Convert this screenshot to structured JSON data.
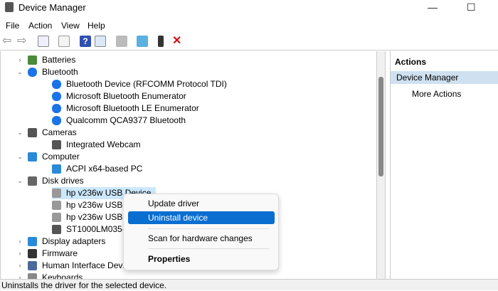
{
  "window": {
    "title": "Device Manager",
    "minimize": "—",
    "maximize": "☐"
  },
  "menu": [
    "File",
    "Action",
    "View",
    "Help"
  ],
  "toolbar": [
    "back",
    "forward",
    "show-hide-console-tree",
    "properties",
    "help",
    "show-hide-action-pane",
    "update-driver",
    "scan-hardware",
    "enable-device",
    "uninstall-device"
  ],
  "tree": [
    {
      "label": "Batteries",
      "level": 0,
      "expand": "›",
      "icon": "battery-icon",
      "color": "#4a8a3a"
    },
    {
      "label": "Bluetooth",
      "level": 0,
      "expand": "⌄",
      "icon": "bluetooth-icon",
      "color": "#1a73e8"
    },
    {
      "label": "Bluetooth Device (RFCOMM Protocol TDI)",
      "level": 1,
      "icon": "bluetooth-icon",
      "color": "#1a73e8"
    },
    {
      "label": "Microsoft Bluetooth Enumerator",
      "level": 1,
      "icon": "bluetooth-icon",
      "color": "#1a73e8"
    },
    {
      "label": "Microsoft Bluetooth LE Enumerator",
      "level": 1,
      "icon": "bluetooth-icon",
      "color": "#1a73e8"
    },
    {
      "label": "Qualcomm QCA9377 Bluetooth",
      "level": 1,
      "icon": "bluetooth-icon",
      "color": "#1a73e8"
    },
    {
      "label": "Cameras",
      "level": 0,
      "expand": "⌄",
      "icon": "camera-icon",
      "color": "#555"
    },
    {
      "label": "Integrated Webcam",
      "level": 1,
      "icon": "camera-icon",
      "color": "#555"
    },
    {
      "label": "Computer",
      "level": 0,
      "expand": "⌄",
      "icon": "monitor-icon",
      "color": "#2a8ad8"
    },
    {
      "label": "ACPI x64-based PC",
      "level": 1,
      "icon": "monitor-icon",
      "color": "#2a8ad8"
    },
    {
      "label": "Disk drives",
      "level": 0,
      "expand": "⌄",
      "icon": "disk-icon",
      "color": "#666"
    },
    {
      "label": "hp v236w USB Device",
      "level": 1,
      "icon": "disk-icon",
      "color": "#999",
      "selected": true
    },
    {
      "label": "hp v236w USB Device",
      "level": 1,
      "icon": "disk-icon",
      "color": "#999"
    },
    {
      "label": "hp v236w USB Device",
      "level": 1,
      "icon": "disk-icon",
      "color": "#999"
    },
    {
      "label": "ST1000LM035-1RK172",
      "level": 1,
      "icon": "disk-icon",
      "color": "#555"
    },
    {
      "label": "Display adapters",
      "level": 0,
      "expand": "›",
      "icon": "display-adapter-icon",
      "color": "#2a8ad8"
    },
    {
      "label": "Firmware",
      "level": 0,
      "expand": "›",
      "icon": "firmware-icon",
      "color": "#333"
    },
    {
      "label": "Human Interface Devices",
      "level": 0,
      "expand": "›",
      "icon": "hid-icon",
      "color": "#4a6a9a"
    },
    {
      "label": "Keyboards",
      "level": 0,
      "expand": "›",
      "icon": "keyboard-icon",
      "color": "#888"
    }
  ],
  "actions": {
    "header": "Actions",
    "selected": "Device Manager",
    "more": "More Actions"
  },
  "context_menu": {
    "update": "Update driver",
    "uninstall": "Uninstall device",
    "scan": "Scan for hardware changes",
    "properties": "Properties"
  },
  "status": "Uninstalls the driver for the selected device."
}
